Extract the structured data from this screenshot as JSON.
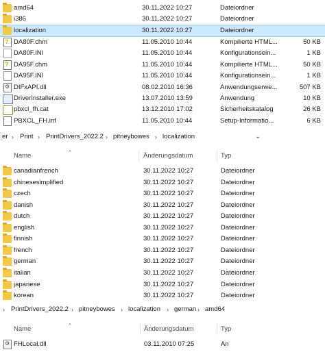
{
  "top_pane": {
    "rows": [
      {
        "icon": "folder",
        "name": "amd64",
        "date": "30.11.2022 10:27",
        "type": "Dateiordner",
        "size": ""
      },
      {
        "icon": "folder",
        "name": "i386",
        "date": "30.11.2022 10:27",
        "type": "Dateiordner",
        "size": ""
      },
      {
        "icon": "folder",
        "name": "localization",
        "date": "30.11.2022 10:27",
        "type": "Dateiordner",
        "size": "",
        "selected": true
      },
      {
        "icon": "chm",
        "name": "DA80F.chm",
        "date": "11.05.2010 10:44",
        "type": "Kompilierte HTML...",
        "size": "50 KB"
      },
      {
        "icon": "ini",
        "name": "DA80F.INI",
        "date": "11.05.2010 10:44",
        "type": "Konfigurationsein...",
        "size": "1 KB"
      },
      {
        "icon": "chm",
        "name": "DA95F.chm",
        "date": "11.05.2010 10:44",
        "type": "Kompilierte HTML...",
        "size": "50 KB"
      },
      {
        "icon": "ini",
        "name": "DA95F.INI",
        "date": "11.05.2010 10:44",
        "type": "Konfigurationsein...",
        "size": "1 KB"
      },
      {
        "icon": "dll",
        "name": "DIFxAPI.dll",
        "date": "08.02.2010 16:36",
        "type": "Anwendungserwe...",
        "size": "507 KB"
      },
      {
        "icon": "exe",
        "name": "DriverInstaller.exe",
        "date": "13.07.2010 13:59",
        "type": "Anwendung",
        "size": "10 KB"
      },
      {
        "icon": "cat",
        "name": "pbxcl_fh.cat",
        "date": "13.12.2010 17:02",
        "type": "Sicherheitskatalog",
        "size": "26 KB"
      },
      {
        "icon": "inf",
        "name": "PBXCL_FH.inf",
        "date": "11.05.2010 10:44",
        "type": "Setup-Informatio...",
        "size": "6 KB"
      }
    ]
  },
  "middle_breadcrumb": {
    "parts": [
      "er",
      "Print",
      "PrintDrivers_2022.2",
      "pitneybowes",
      "localization"
    ],
    "separator": "›",
    "dropdown": "⌄"
  },
  "middle_header": {
    "name": "Name",
    "date": "Änderungsdatum",
    "type": "Typ",
    "sort_arrow": "^"
  },
  "middle_pane": {
    "rows": [
      {
        "name": "canadianfrench",
        "date": "30.11.2022 10:27",
        "type": "Dateiordner"
      },
      {
        "name": "chinesesimplified",
        "date": "30.11.2022 10:27",
        "type": "Dateiordner"
      },
      {
        "name": "czech",
        "date": "30.11.2022 10:27",
        "type": "Dateiordner"
      },
      {
        "name": "danish",
        "date": "30.11.2022 10:27",
        "type": "Dateiordner"
      },
      {
        "name": "dutch",
        "date": "30.11.2022 10:27",
        "type": "Dateiordner"
      },
      {
        "name": "english",
        "date": "30.11.2022 10:27",
        "type": "Dateiordner"
      },
      {
        "name": "finnish",
        "date": "30.11.2022 10:27",
        "type": "Dateiordner"
      },
      {
        "name": "french",
        "date": "30.11.2022 10:27",
        "type": "Dateiordner"
      },
      {
        "name": "german",
        "date": "30.11.2022 10:27",
        "type": "Dateiordner"
      },
      {
        "name": "italian",
        "date": "30.11.2022 10:27",
        "type": "Dateiordner"
      },
      {
        "name": "japanese",
        "date": "30.11.2022 10:27",
        "type": "Dateiordner"
      },
      {
        "name": "korean",
        "date": "30.11.2022 10:27",
        "type": "Dateiordner"
      }
    ]
  },
  "bottom_breadcrumb": {
    "parts": [
      "PrintDrivers_2022.2",
      "pitneybowes",
      "localization",
      "german",
      "amd64"
    ],
    "separator": "›"
  },
  "bottom_header": {
    "name": "Name",
    "date": "Änderungsdatum",
    "type": "Typ",
    "sort_arrow": "^"
  },
  "bottom_pane": {
    "rows": [
      {
        "name": "FHLocal.dll",
        "date": "03.11.2010 07:25",
        "type": "An"
      }
    ]
  }
}
